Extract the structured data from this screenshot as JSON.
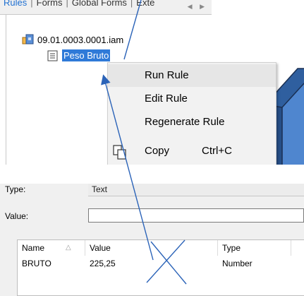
{
  "tabs": [
    "Rules",
    "Forms",
    "Global Forms",
    "Exte"
  ],
  "tab_separator": "|",
  "tree": {
    "assembly_label": "09.01.0003.0001.iam",
    "rule_label": "Peso Bruto",
    "assembly_icon": "assembly-icon",
    "rule_icon": "rule-icon"
  },
  "context_menu": {
    "items": [
      {
        "label": "Run Rule",
        "shortcut": ""
      },
      {
        "label": "Edit Rule",
        "shortcut": ""
      },
      {
        "label": "Regenerate Rule",
        "shortcut": ""
      },
      {
        "label": "Copy",
        "shortcut": "Ctrl+C",
        "icon": "copy-icon"
      }
    ]
  },
  "properties": {
    "type_label": "Type:",
    "type_value": "Text",
    "value_label": "Value:",
    "value_value": ""
  },
  "table": {
    "columns": [
      "Name",
      "Value",
      "Type"
    ],
    "rows": [
      {
        "name": "BRUTO",
        "value": "225,25",
        "type": "Number"
      }
    ]
  },
  "colors": {
    "selection": "#2f7ad8",
    "annotation": "#2b63b8",
    "model": "#3f79c4"
  }
}
